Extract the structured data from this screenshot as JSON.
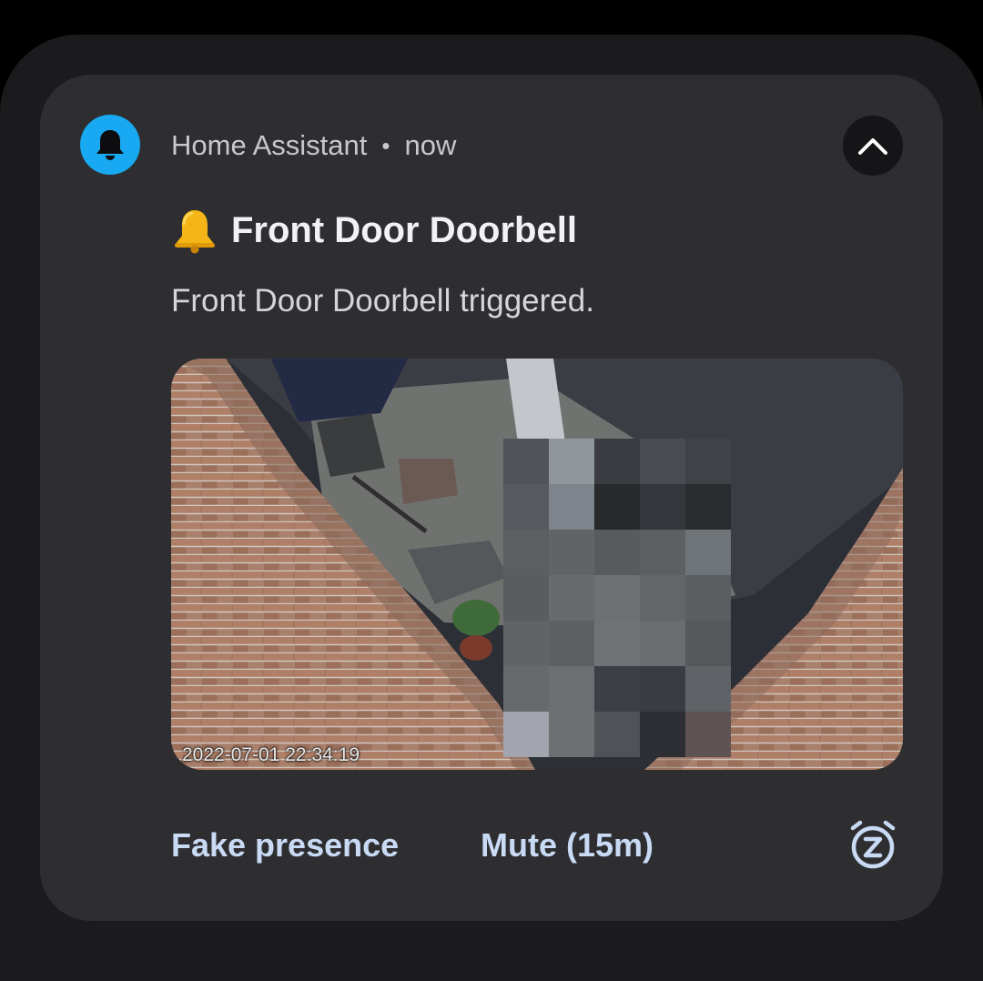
{
  "notification": {
    "app_name": "Home Assistant",
    "separator": "•",
    "time": "now",
    "app_icon": "bell-icon",
    "app_icon_color": "#18a9f2",
    "expand_icon": "chevron-up-icon",
    "title": "Front Door Doorbell",
    "title_emoji": "bell-emoji",
    "message": "Front Door Doorbell triggered.",
    "image": {
      "description_icon": "camera-snapshot",
      "timestamp": "2022-07-01 22:34:19"
    },
    "actions": [
      {
        "label": "Fake presence"
      },
      {
        "label": "Mute (15m)"
      }
    ],
    "snooze_icon": "snooze-alarm-icon",
    "colors": {
      "card_background": "#2e2e31",
      "action_text": "#c9daf5",
      "title_text": "#f2f2f4"
    }
  }
}
